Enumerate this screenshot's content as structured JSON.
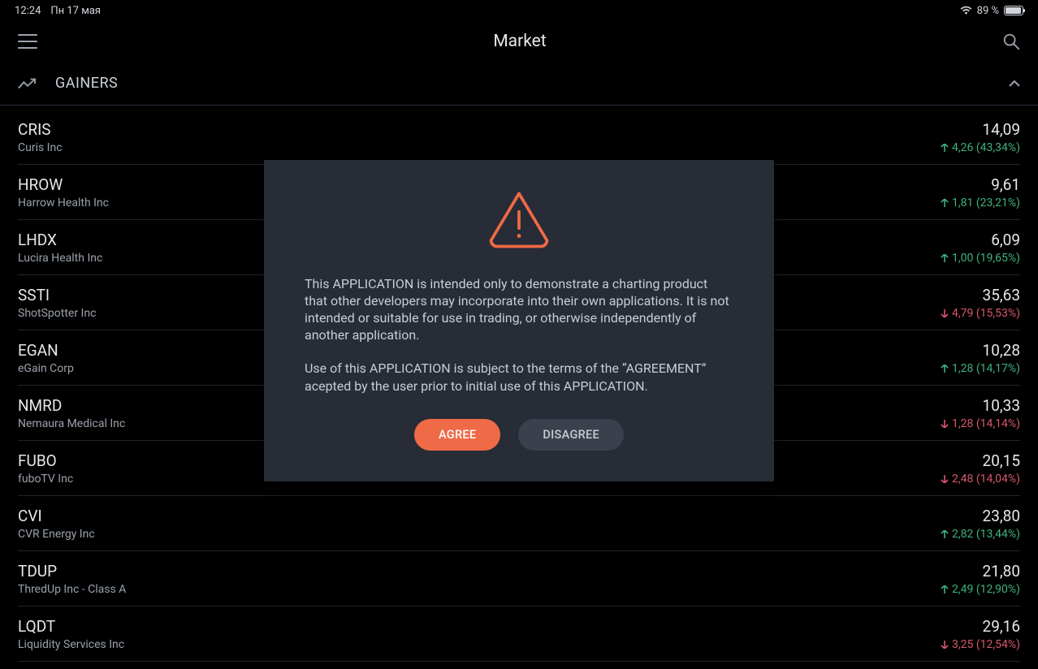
{
  "status": {
    "time": "12:24",
    "date": "Пн 17 мая",
    "battery_percent": "89 %"
  },
  "header": {
    "title": "Market"
  },
  "section": {
    "title": "GAINERS"
  },
  "colors": {
    "up": "#3fb27f",
    "down": "#d9576b",
    "accent": "#ef6a47"
  },
  "rows": [
    {
      "ticker": "CRIS",
      "company": "Curis Inc",
      "price": "14,09",
      "dir": "up",
      "change": "4,26 (43,34%)"
    },
    {
      "ticker": "HROW",
      "company": "Harrow Health Inc",
      "price": "9,61",
      "dir": "up",
      "change": "1,81 (23,21%)"
    },
    {
      "ticker": "LHDX",
      "company": "Lucira Health Inc",
      "price": "6,09",
      "dir": "up",
      "change": "1,00 (19,65%)"
    },
    {
      "ticker": "SSTI",
      "company": "ShotSpotter Inc",
      "price": "35,63",
      "dir": "down",
      "change": "4,79 (15,53%)"
    },
    {
      "ticker": "EGAN",
      "company": "eGain Corp",
      "price": "10,28",
      "dir": "up",
      "change": "1,28 (14,17%)"
    },
    {
      "ticker": "NMRD",
      "company": "Nemaura Medical Inc",
      "price": "10,33",
      "dir": "down",
      "change": "1,28 (14,14%)"
    },
    {
      "ticker": "FUBO",
      "company": "fuboTV Inc",
      "price": "20,15",
      "dir": "down",
      "change": "2,48 (14,04%)"
    },
    {
      "ticker": "CVI",
      "company": "CVR Energy Inc",
      "price": "23,80",
      "dir": "up",
      "change": "2,82 (13,44%)"
    },
    {
      "ticker": "TDUP",
      "company": "ThredUp Inc - Class A",
      "price": "21,80",
      "dir": "up",
      "change": "2,49 (12,90%)"
    },
    {
      "ticker": "LQDT",
      "company": "Liquidity Services Inc",
      "price": "29,16",
      "dir": "down",
      "change": "3,25 (12,54%)"
    }
  ],
  "modal": {
    "paragraph1": "This APPLICATION is intended only to demonstrate a charting product that other developers may incorporate into their own applications. It is not intended or suitable for use in trading, or otherwise independently of another application.",
    "paragraph2": "Use of this APPLICATION is subject to the terms of the “AGREEMENT” acepted by the user prior to initial use of this APPLICATION.",
    "agree": "AGREE",
    "disagree": "DISAGREE"
  }
}
